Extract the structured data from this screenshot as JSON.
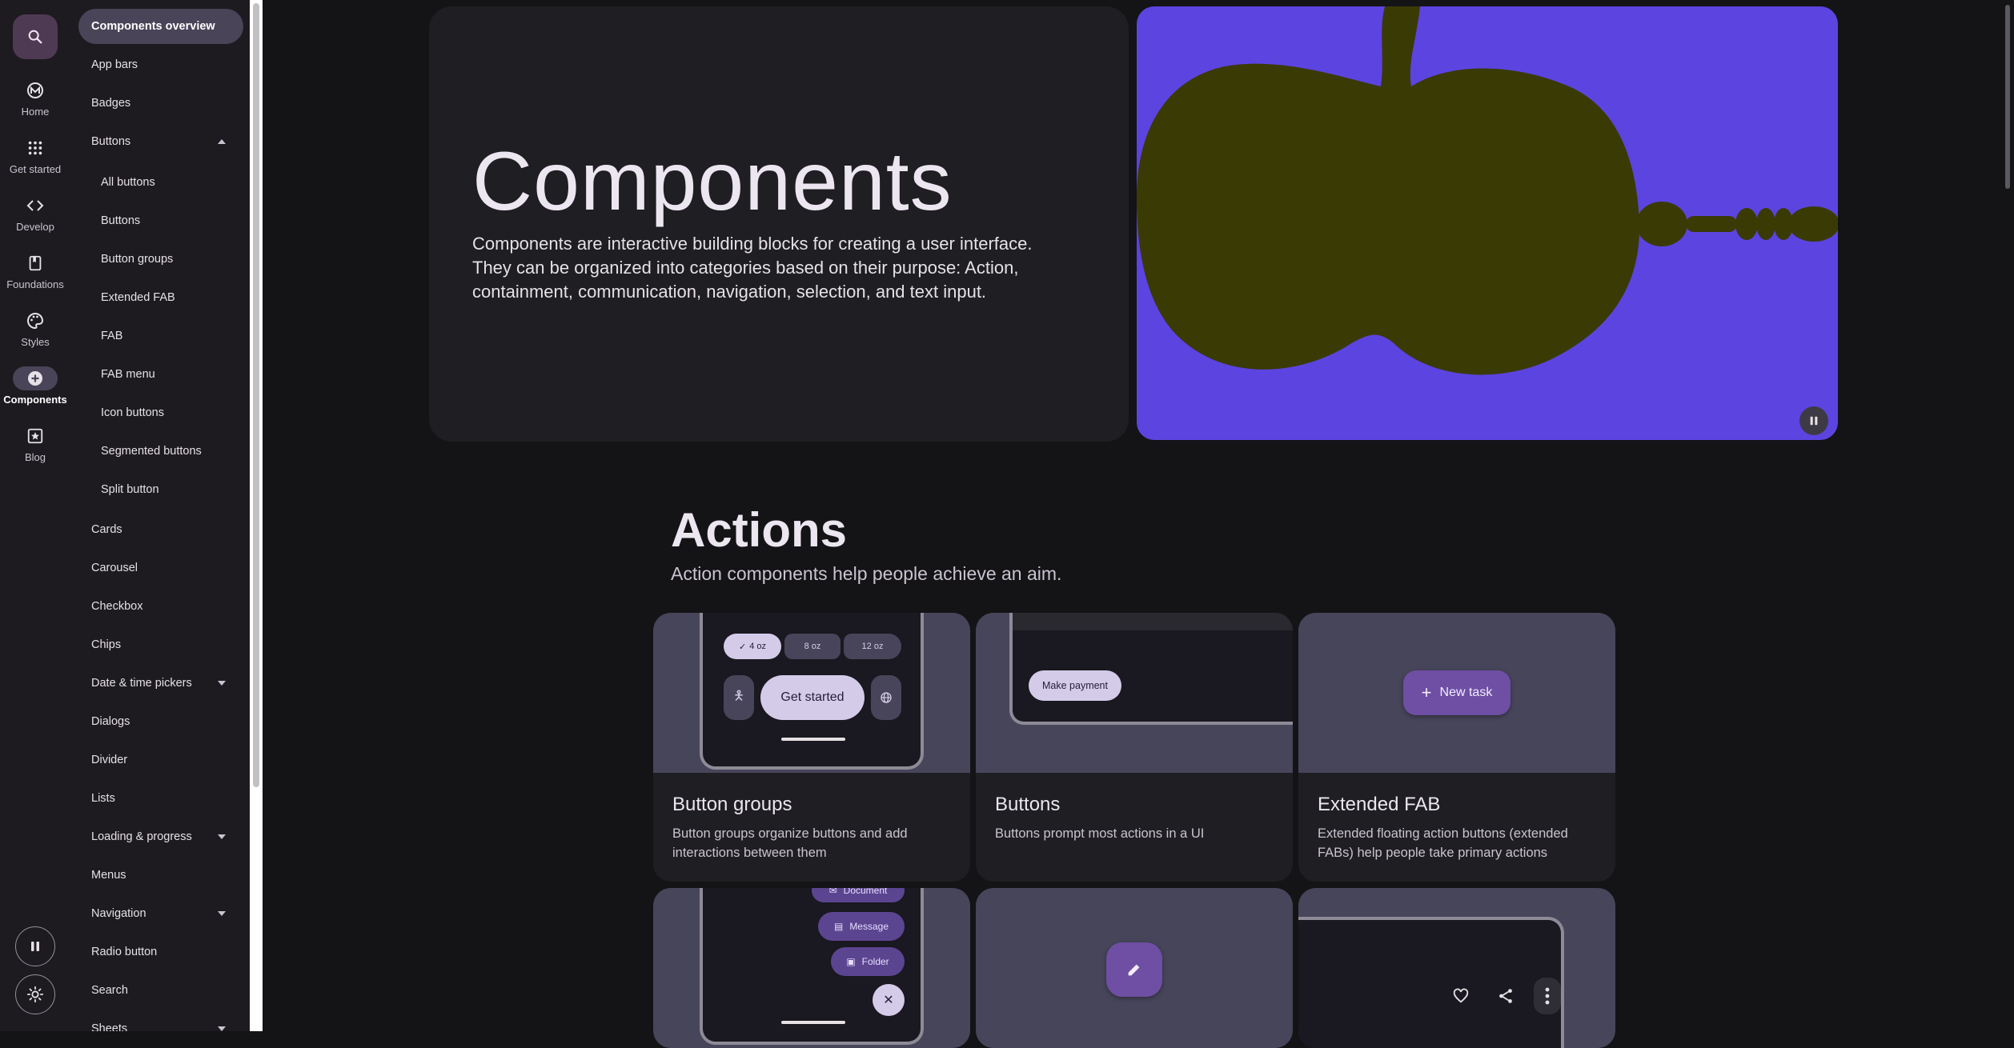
{
  "rail": {
    "items": [
      {
        "label": "Home",
        "icon": "material-logo-icon"
      },
      {
        "label": "Get started",
        "icon": "apps-grid-icon"
      },
      {
        "label": "Develop",
        "icon": "code-icon"
      },
      {
        "label": "Foundations",
        "icon": "book-icon"
      },
      {
        "label": "Styles",
        "icon": "palette-icon"
      },
      {
        "label": "Components",
        "icon": "add-circle-icon"
      },
      {
        "label": "Blog",
        "icon": "star-box-icon"
      }
    ]
  },
  "sidenav": {
    "items": [
      {
        "label": "Components overview"
      },
      {
        "label": "App bars"
      },
      {
        "label": "Badges"
      },
      {
        "label": "Buttons"
      },
      {
        "label": "All buttons"
      },
      {
        "label": "Buttons"
      },
      {
        "label": "Button groups"
      },
      {
        "label": "Extended FAB"
      },
      {
        "label": "FAB"
      },
      {
        "label": "FAB menu"
      },
      {
        "label": "Icon buttons"
      },
      {
        "label": "Segmented buttons"
      },
      {
        "label": "Split button"
      },
      {
        "label": "Cards"
      },
      {
        "label": "Carousel"
      },
      {
        "label": "Checkbox"
      },
      {
        "label": "Chips"
      },
      {
        "label": "Date & time pickers"
      },
      {
        "label": "Dialogs"
      },
      {
        "label": "Divider"
      },
      {
        "label": "Lists"
      },
      {
        "label": "Loading & progress"
      },
      {
        "label": "Menus"
      },
      {
        "label": "Navigation"
      },
      {
        "label": "Radio button"
      },
      {
        "label": "Search"
      },
      {
        "label": "Sheets"
      }
    ]
  },
  "hero": {
    "title": "Components",
    "description": "Components are interactive building blocks for creating a user interface. They can be organized into categories based on their purpose: Action, containment, communication, navigation, selection, and text input."
  },
  "actions": {
    "title": "Actions",
    "description": "Action components help people achieve an aim.",
    "cards": [
      {
        "title": "Button groups",
        "description": "Button groups organize buttons and add interactions between them"
      },
      {
        "title": "Buttons",
        "description": "Buttons prompt most actions in a UI"
      },
      {
        "title": "Extended FAB",
        "description": "Extended floating action buttons (extended FABs) help people take primary actions"
      }
    ]
  },
  "demo": {
    "sizes": [
      "4 oz",
      "8 oz",
      "12 oz"
    ],
    "get_started": "Get started",
    "make_payment": "Make payment",
    "new_task": "New task",
    "fab_menu": [
      "Document",
      "Message",
      "Folder"
    ]
  },
  "colors": {
    "accent": "#4a4458",
    "hero_media_bg": "#5c44e0",
    "shape": "#3a3a05",
    "fab": "#6e4fa3"
  }
}
